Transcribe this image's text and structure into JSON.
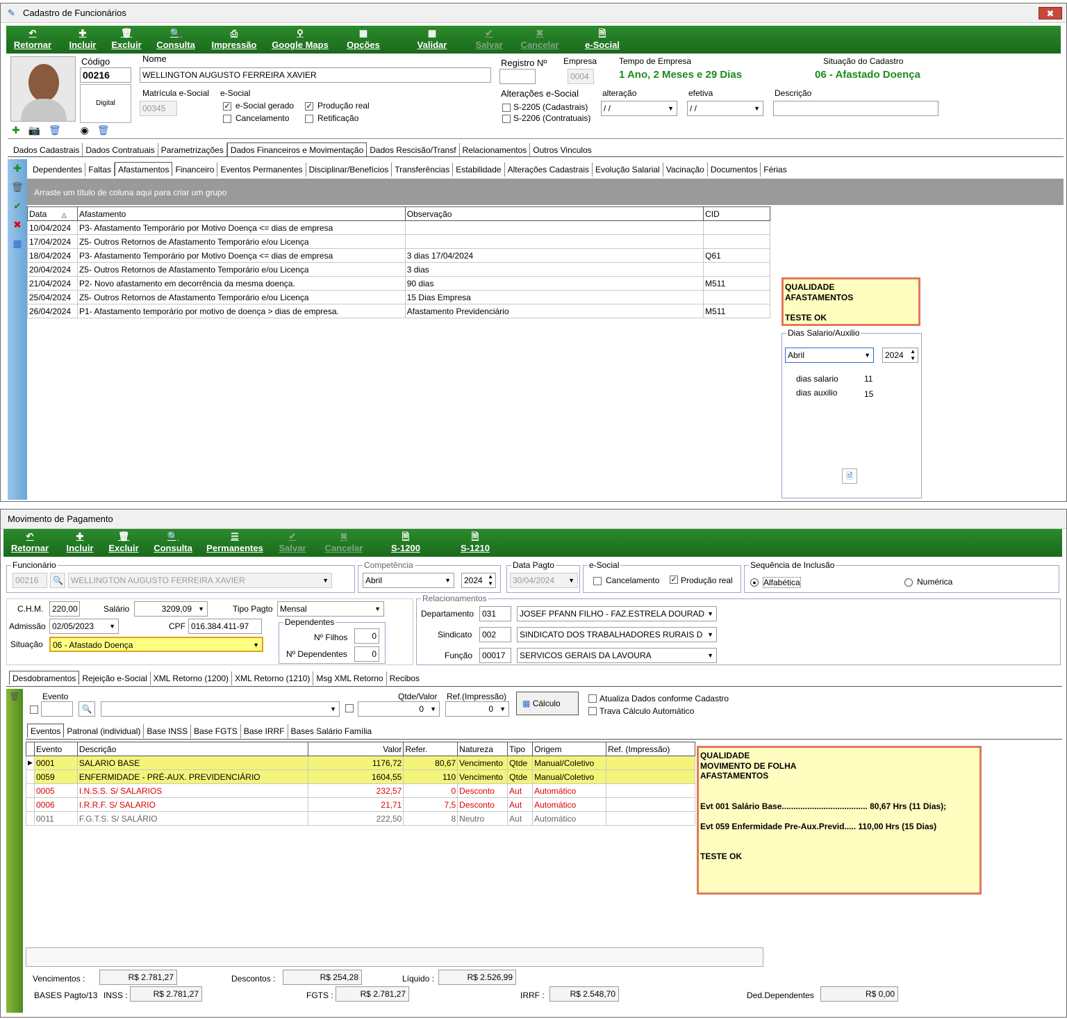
{
  "win1": {
    "title": "Cadastro de Funcionários",
    "toolbar": [
      "Retornar",
      "Incluir",
      "Excluir",
      "Consulta",
      "Impressão",
      "Google Maps",
      "Opções",
      "Validar",
      "Salvar",
      "Cancelar",
      "e-Social"
    ],
    "codigo_label": "Código",
    "codigo": "00216",
    "digital": "Digital",
    "nome_label": "Nome",
    "nome": "WELLINGTON AUGUSTO FERREIRA XAVIER",
    "registro_label": "Registro Nº",
    "empresa_label": "Empresa",
    "empresa": "0004",
    "tempo_label": "Tempo de Empresa",
    "tempo": "1 Ano, 2 Meses  e 29 Dias",
    "situacao_label": "Situação do Cadastro",
    "situacao": "06 - Afastado Doença",
    "matricula_label": "Matrícula e-Social",
    "matricula": "00345",
    "esocial_label": "e-Social",
    "esocial_gerado": "e-Social gerado",
    "producao": "Produção real",
    "cancelamento": "Cancelamento",
    "retificacao": "Retificação",
    "alteracoes_label": "Alterações e-Social",
    "s2205": "S-2205 (Cadastrais)",
    "s2206": "S-2206 (Contratuais)",
    "alteracao_label": "alteração",
    "alteracao": "/ /",
    "efetiva_label": "efetiva",
    "efetiva": "/ /",
    "descricao_label": "Descrição",
    "tabs1": [
      "Dados Cadastrais",
      "Dados Contratuais",
      "Parametrizações",
      "Dados Financeiros e Movimentação",
      "Dados Rescisão/Transf",
      "Relacionamentos",
      "Outros Vinculos"
    ],
    "tabs2": [
      "Dependentes",
      "Faltas",
      "Afastamentos",
      "Financeiro",
      "Eventos Permanentes",
      "Disciplinar/Benefícios",
      "Transferências",
      "Estabilidade",
      "Alterações Cadastrais",
      "Evolução Salarial",
      "Vacinação",
      "Documentos",
      "Férias"
    ],
    "group_hint": "Arraste um título de coluna aqui para criar um grupo",
    "grid_headers": [
      "Data",
      "Afastamento",
      "Observação",
      "CID"
    ],
    "grid_rows": [
      [
        "10/04/2024",
        "P3- Afastamento Temporário por Motivo Doença <= dias de empresa",
        "",
        ""
      ],
      [
        "17/04/2024",
        "Z5- Outros Retornos de Afastamento Temporário e/ou Licença",
        "",
        ""
      ],
      [
        "18/04/2024",
        "P3- Afastamento Temporário por Motivo Doença <= dias de empresa",
        "3 dias 17/04/2024",
        "Q61"
      ],
      [
        "20/04/2024",
        "Z5- Outros Retornos de Afastamento Temporário e/ou Licença",
        "3 dias",
        ""
      ],
      [
        "21/04/2024",
        "P2- Novo afastamento em decorrência da mesma doença.",
        "90 dias",
        "M511"
      ],
      [
        "25/04/2024",
        "Z5- Outros Retornos de Afastamento Temporário e/ou Licença",
        "15 Dias Empresa",
        ""
      ],
      [
        "26/04/2024",
        "P1- Afastamento temporário por motivo de doença > dias de empresa.",
        "Afastamento Previdenciário",
        "M511"
      ]
    ],
    "note": "QUALIDADE\nAFASTAMENTOS\n\nTESTE OK",
    "dias_title": "Dias Salario/Auxilio",
    "mes": "Abril",
    "ano": "2024",
    "dias_salario_label": "dias salario",
    "dias_salario": "11",
    "dias_auxilio_label": "dias auxilio",
    "dias_auxilio": "15"
  },
  "win2": {
    "title": "Movimento de Pagamento",
    "toolbar": [
      "Retornar",
      "Incluir",
      "Excluir",
      "Consulta",
      "Permanentes",
      "Salvar",
      "Cancelar",
      "S-1200",
      "S-1210"
    ],
    "funcionario_label": "Funcionário",
    "func_cod": "00216",
    "func_nome": "WELLINGTON AUGUSTO FERREIRA XAVIER",
    "competencia_label": "Competência",
    "comp_mes": "Abril",
    "comp_ano": "2024",
    "datapagto_label": "Data Pagto",
    "datapagto": "30/04/2024",
    "esocial_label": "e-Social",
    "cancelamento": "Cancelamento",
    "producao": "Produção real",
    "sequencia_label": "Sequência de Inclusão",
    "alfabetica": "Alfabética",
    "numerica": "Numérica",
    "chm_label": "C.H.M.",
    "chm": "220,00",
    "salario_label": "Salário",
    "salario": "3209,09",
    "tipopagto_label": "Tipo Pagto",
    "tipopagto": "Mensal",
    "admissao_label": "Admissão",
    "admissao": "02/05/2023",
    "cpf_label": "CPF",
    "cpf": "016.384.411-97",
    "situacao_label": "Situação",
    "situacao": "06 - Afastado Doença",
    "dependentes_label": "Dependentes",
    "nfilhos_label": "Nº Filhos",
    "nfilhos": "0",
    "ndep_label": "Nº Dependentes",
    "ndep": "0",
    "relac_label": "Relacionamentos",
    "depto_label": "Departamento",
    "depto_cod": "031",
    "depto": "JOSEF PFANN FILHO - FAZ.ESTRELA DOURAD",
    "sindicato_label": "Sindicato",
    "sind_cod": "002",
    "sindicato": "SINDICATO DOS TRABALHADORES RURAIS D",
    "funcao_label": "Função",
    "funcao_cod": "00017",
    "funcao": "SERVICOS GERAIS DA LAVOURA",
    "tabs1": [
      "Desdobramentos",
      "Rejeição e-Social",
      "XML Retorno (1200)",
      "XML Retorno (1210)",
      "Msg XML Retorno",
      "Recibos"
    ],
    "evento_label": "Evento",
    "qtde_label": "Qtde/Valor",
    "qtde": "0",
    "ref_label": "Ref.(Impressão)",
    "ref": "0",
    "calculo": "Cálculo",
    "atualiza": "Atualiza Dados conforme Cadastro",
    "trava": "Trava Cálculo Automático",
    "tabs2": [
      "Eventos",
      "Patronal (individual)",
      "Base INSS",
      "Base FGTS",
      "Base IRRF",
      "Bases Salário Família"
    ],
    "grid_headers": [
      "Evento",
      "Descrição",
      "Valor",
      "Refer.",
      "Natureza",
      "Tipo",
      "Origem",
      "Ref. (Impressão)"
    ],
    "grid_rows": [
      [
        "0001",
        "SALARIO BASE",
        "1176,72",
        "80,67",
        "Vencimento",
        "Qtde",
        "Manual/Coletivo",
        ""
      ],
      [
        "0059",
        "ENFERMIDADE - PRÉ-AUX. PREVIDENCIÁRIO",
        "1604,55",
        "110",
        "Vencimento",
        "Qtde",
        "Manual/Coletivo",
        ""
      ],
      [
        "0005",
        "I.N.S.S. S/ SALARIOS",
        "232,57",
        "0",
        "Desconto",
        "Aut",
        "Automático",
        ""
      ],
      [
        "0006",
        "I.R.R.F. S/ SALARIO",
        "21,71",
        "7,5",
        "Desconto",
        "Aut",
        "Automático",
        ""
      ],
      [
        "0011",
        "F.G.T.S. S/ SALÁRIO",
        "222,50",
        "8",
        "Neutro",
        "Aut",
        "Automático",
        ""
      ]
    ],
    "note": "QUALIDADE\nMOVIMENTO DE FOLHA\nAFASTAMENTOS\n\n\nEvt 001 Salário Base.....................................      80,67 Hrs (11 Dias);\n\nEvt 059 Enfermidade Pre-Aux.Previd.....  110,00 Hrs (15 Dias)\n\n\nTESTE OK",
    "venc_label": "Vencimentos :",
    "venc": "R$ 2.781,27",
    "desc_label": "Descontos :",
    "desc": "R$ 254,28",
    "liq_label": "Líquido :",
    "liq": "R$ 2.526,99",
    "bases_label": "BASES Pagto/13",
    "inss_label": "INSS :",
    "inss": "R$ 2.781,27",
    "fgts_label": "FGTS :",
    "fgts": "R$ 2.781,27",
    "irrf_label": "IRRF :",
    "irrf": "R$ 2.548,70",
    "deddep_label": "Ded.Dependentes",
    "deddep": "R$ 0,00"
  }
}
